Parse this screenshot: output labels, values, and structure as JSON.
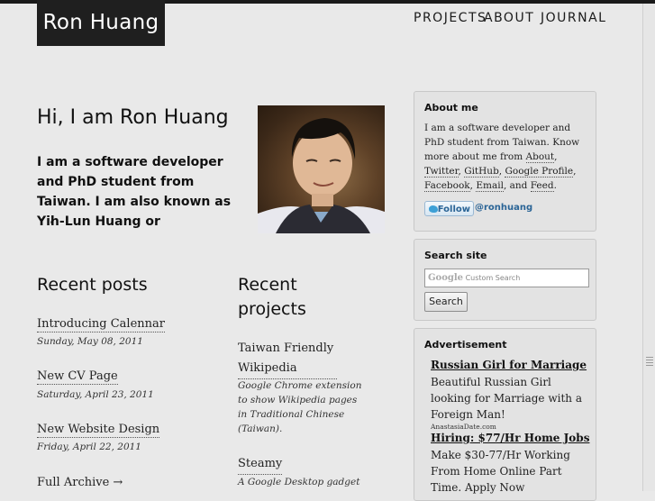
{
  "site": {
    "brand": "Ron Huang"
  },
  "nav": {
    "projects": "PROJECTS",
    "about": "ABOUT",
    "journal": "JOURNAL"
  },
  "hero": {
    "title": "Hi, I am Ron Huang",
    "text": "I am a software developer and PhD student from Taiwan. I am also known as Yih-Lun Huang or",
    "trail": "."
  },
  "recent_posts": {
    "heading": "Recent posts",
    "items": [
      {
        "title": "Introducing Calennar",
        "date": "Sunday, May 08, 2011"
      },
      {
        "title": "New CV Page",
        "date": "Saturday, April 23, 2011"
      },
      {
        "title": "New Website Design",
        "date": "Friday, April 22, 2011"
      }
    ],
    "archive": "Full Archive →"
  },
  "recent_projects": {
    "heading": "Recent projects",
    "items": [
      {
        "title": "Taiwan Friendly Wikipedia",
        "desc": "Google Chrome extension to show Wikipedia pages in Traditional Chinese (Taiwan)."
      },
      {
        "title": "Steamy",
        "desc": "A Google Desktop gadget"
      }
    ]
  },
  "about_box": {
    "heading": "About me",
    "intro": "I am a software developer and PhD student from Taiwan. Know more about me from",
    "links": {
      "about": "About",
      "twitter": "Twitter",
      "github": "GitHub",
      "google_profile": "Google Profile",
      "facebook": "Facebook",
      "email": "Email",
      "feed": "Feed"
    },
    "sep_comma": ",",
    "and_text": ", and",
    "end": ".",
    "follow_label": "Follow",
    "follow_handle": "@ronhuang"
  },
  "search_box": {
    "heading": "Search site",
    "google_word": "Google",
    "placeholder": "Custom Search",
    "button": "Search"
  },
  "ad_box": {
    "heading": "Advertisement",
    "ads": [
      {
        "title": "Russian Girl for Marriage",
        "body": "Beautiful Russian Girl looking for Marriage with a Foreign Man!",
        "url": "AnastasiaDate.com"
      },
      {
        "title": "Hiring: $77/Hr Home Jobs",
        "body": "Make $30-77/Hr Working From Home Online Part Time. Apply Now"
      }
    ]
  },
  "colors": {
    "background": "#e9e9e9",
    "brand_bg": "#1f1f1f",
    "twitter_blue": "#2a6496"
  }
}
